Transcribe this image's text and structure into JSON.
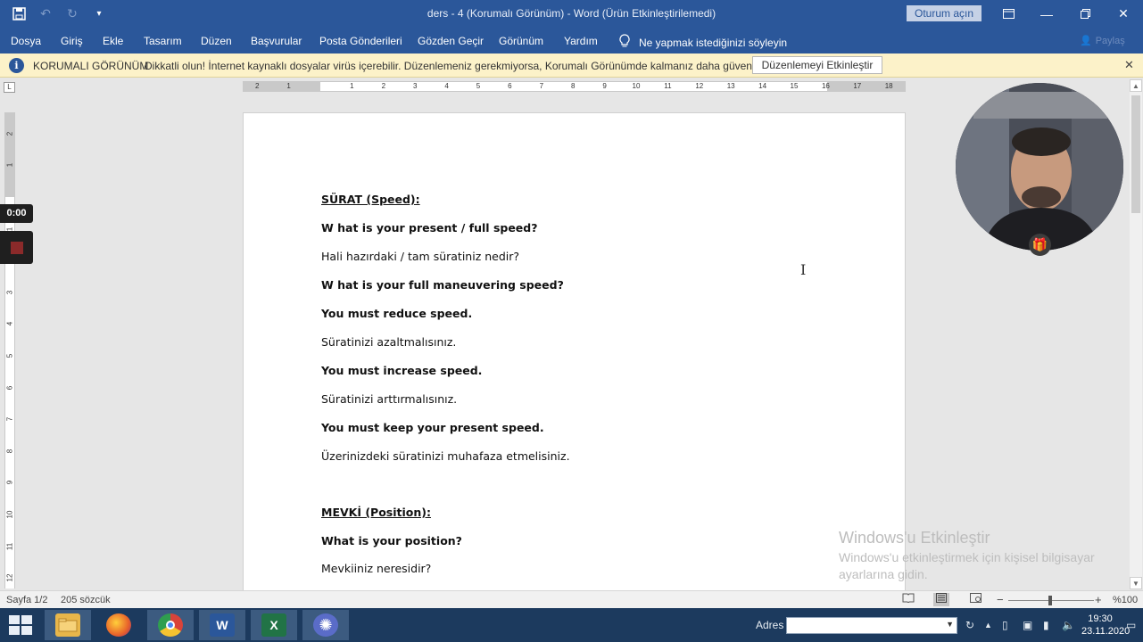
{
  "titlebar": {
    "title": "ders - 4 (Korumalı Görünüm)  -  Word (Ürün Etkinleştirilemedi)",
    "signin": "Oturum açın"
  },
  "ribbon": {
    "tabs": [
      "Dosya",
      "Giriş",
      "Ekle",
      "Tasarım",
      "Düzen",
      "Başvurular",
      "Posta Gönderileri",
      "Gözden Geçir",
      "Görünüm",
      "Yardım"
    ],
    "tell_me": "Ne yapmak istediğinizi söyleyin",
    "share": "Paylaş"
  },
  "protected_view": {
    "title": "KORUMALI GÖRÜNÜM",
    "message": "Dikkatli olun! İnternet kaynaklı dosyalar virüs içerebilir. Düzenlemeniz gerekmiyorsa, Korumalı Görünümde kalmanız daha güvenli olur.",
    "enable_button": "Düzenlemeyi Etkinleştir"
  },
  "ruler": {
    "corner": "L",
    "h_ticks": [
      "2",
      "1",
      "1",
      "2",
      "3",
      "4",
      "5",
      "6",
      "7",
      "8",
      "9",
      "10",
      "11",
      "12",
      "13",
      "14",
      "15",
      "16",
      "17",
      "18"
    ],
    "v_ticks": [
      "2",
      "1",
      "1",
      "2",
      "3",
      "4",
      "5",
      "6",
      "7",
      "8",
      "9",
      "10",
      "11",
      "12"
    ]
  },
  "document": {
    "paragraphs": [
      {
        "text": "SÜRAT (Speed):",
        "bold": true,
        "underline": true
      },
      {
        "text": "W hat is your present / full speed?",
        "bold": true,
        "underline": false
      },
      {
        "text": "Hali hazırdaki / tam süratiniz nedir?",
        "bold": false,
        "underline": false
      },
      {
        "text": "W hat is your full maneuvering speed?",
        "bold": true,
        "underline": false
      },
      {
        "text": "You must reduce speed.",
        "bold": true,
        "underline": false
      },
      {
        "text": "Süratinizi azaltmalısınız.",
        "bold": false,
        "underline": false
      },
      {
        "text": "You must increase speed.",
        "bold": true,
        "underline": false
      },
      {
        "text": "Süratinizi arttırmalısınız.",
        "bold": false,
        "underline": false
      },
      {
        "text": "You must keep your present speed.",
        "bold": true,
        "underline": false
      },
      {
        "text": "Üzerinizdeki süratinizi muhafaza etmelisiniz.",
        "bold": false,
        "underline": false
      },
      {
        "text": "MEVKİ (Position):",
        "bold": true,
        "underline": true
      },
      {
        "text": "What is your position?",
        "bold": true,
        "underline": false
      },
      {
        "text": "Mevkiiniz neresidir?",
        "bold": false,
        "underline": false
      }
    ]
  },
  "recording": {
    "timer": "0:00"
  },
  "watermark": {
    "title": "Windows'u Etkinleştir",
    "body": "Windows'u etkinleştirmek için kişisel bilgisayar ayarlarına gidin."
  },
  "statusbar": {
    "page": "Sayfa 1/2",
    "words": "205 sözcük",
    "zoom": "%100",
    "zoom_level_percent": 100
  },
  "taskbar": {
    "apps": [
      {
        "name": "file-explorer",
        "color": "#e8b64a"
      },
      {
        "name": "firefox",
        "color": "#e8622a"
      },
      {
        "name": "chrome",
        "color": "#d9433a"
      },
      {
        "name": "word",
        "color": "#2b579a",
        "glyph": "W"
      },
      {
        "name": "excel",
        "color": "#217346",
        "glyph": "X"
      },
      {
        "name": "other-app",
        "color": "#5a6cc8"
      }
    ],
    "address_label": "Adres",
    "time": "19:30",
    "date": "23.11.2020"
  }
}
